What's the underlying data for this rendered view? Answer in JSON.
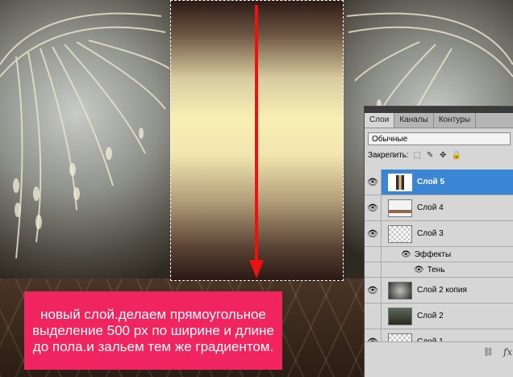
{
  "caption": {
    "text": "новый слой.делаем прямоугольное выделение 500 px по ширине и длине до пола.и зальем тем же градиентом."
  },
  "panel": {
    "tabs": [
      {
        "label": "Слои",
        "active": true
      },
      {
        "label": "Каналы",
        "active": false
      },
      {
        "label": "Контуры",
        "active": false
      }
    ],
    "blend_mode": "Обычные",
    "lock_label": "Закрепить:",
    "lock_icons": [
      "lock-transparency-icon",
      "lock-brush-icon",
      "lock-move-icon",
      "lock-all-icon"
    ],
    "layers": [
      {
        "name": "Слой 5",
        "visible": true,
        "selected": true
      },
      {
        "name": "Слой 4",
        "visible": true,
        "selected": false
      },
      {
        "name": "Слой 3",
        "visible": true,
        "selected": false
      },
      {
        "name": "Эффекты",
        "visible": true,
        "sub": true
      },
      {
        "name": "Тень",
        "visible": true,
        "sub": true
      },
      {
        "name": "Слой 2 копия",
        "visible": true,
        "selected": false
      },
      {
        "name": "Слой 2",
        "visible": false,
        "selected": false
      },
      {
        "name": "Слой 1",
        "visible": true,
        "selected": false
      }
    ],
    "footer_fx": "fx"
  },
  "colors": {
    "caption_bg": "#f0245e",
    "selection_blue": "#3a86d4",
    "arrow_red": "#ee1111"
  }
}
